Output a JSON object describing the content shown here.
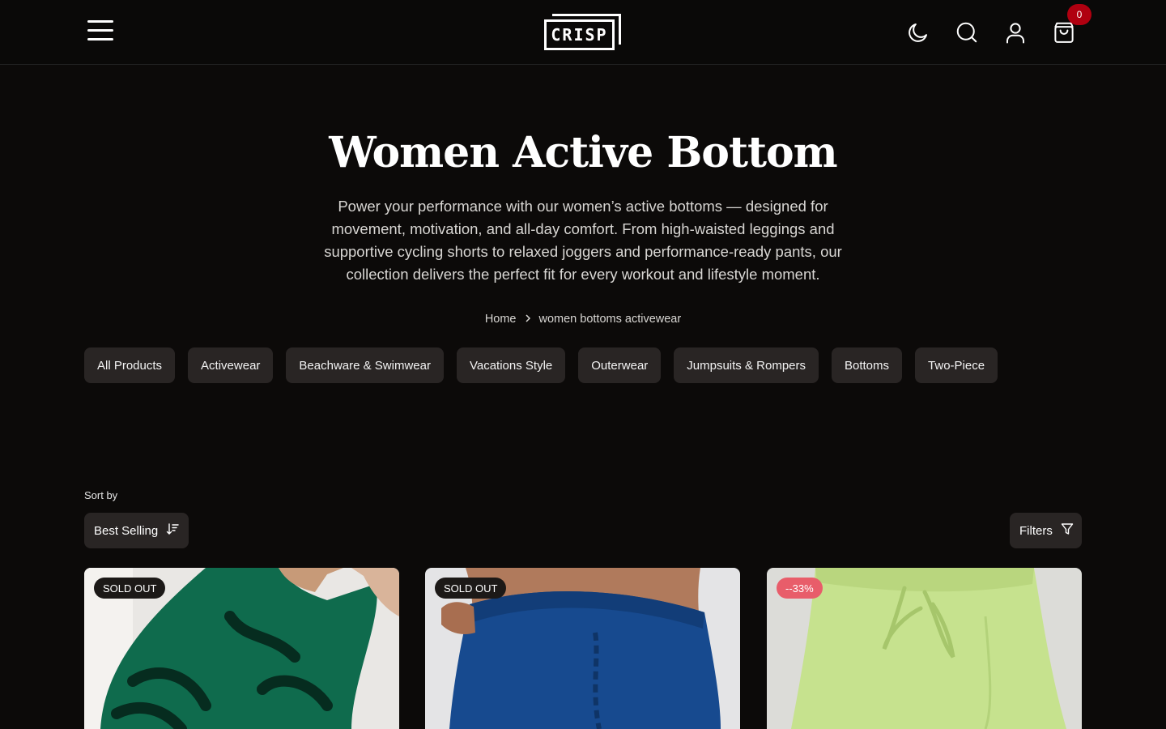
{
  "header": {
    "logo_text": "CRISP",
    "cart_count": "0",
    "icons": [
      "menu-icon",
      "moon-icon",
      "search-icon",
      "user-icon",
      "bag-icon"
    ]
  },
  "hero": {
    "title": "Women Active Bottom",
    "description": "Power your performance with our women’s active bottoms — designed for movement, motivation, and all-day comfort. From high-waisted leggings and supportive cycling shorts to relaxed joggers and performance-ready pants, our collection delivers the perfect fit for every workout and lifestyle moment."
  },
  "breadcrumb": {
    "home": "Home",
    "current": "women bottoms activewear"
  },
  "categories": [
    {
      "label": "All Products"
    },
    {
      "label": "Activewear"
    },
    {
      "label": "Beachware & Swimwear"
    },
    {
      "label": "Vacations Style"
    },
    {
      "label": "Outerwear"
    },
    {
      "label": "Jumpsuits & Rompers"
    },
    {
      "label": "Bottoms"
    },
    {
      "label": "Two-Piece"
    }
  ],
  "toolbar": {
    "sort_label": "Sort by",
    "sort_value": "Best Selling",
    "filters_label": "Filters"
  },
  "products": [
    {
      "badge": "SOLD OUT",
      "badge_style": "dark",
      "image": "green tie-dye leggings",
      "color": "#0f6b4d"
    },
    {
      "badge": "SOLD OUT",
      "badge_style": "dark",
      "image": "blue seamless leggings",
      "color": "#174a8f"
    },
    {
      "badge": "--33%",
      "badge_style": "sale",
      "image": "lime green drawstring shorts",
      "color": "#c6e28e"
    }
  ],
  "colors": {
    "background": "#0c0a09",
    "chip": "#292524",
    "cart_badge": "#b00010",
    "sale_badge": "#e85d6a"
  }
}
